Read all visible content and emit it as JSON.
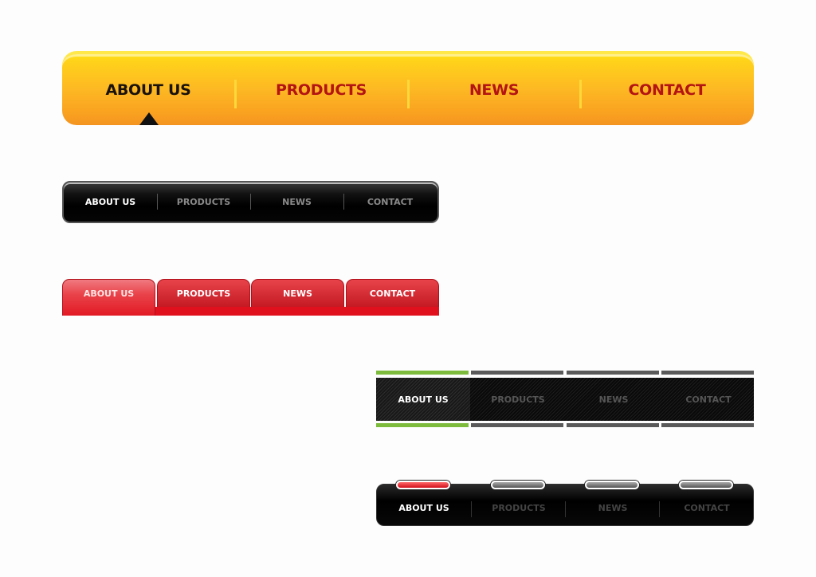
{
  "menu_items": [
    "ABOUT US",
    "PRODUCTS",
    "NEWS",
    "CONTACT"
  ],
  "active_item": "ABOUT US",
  "colors": {
    "orange_nav": "#fdb823",
    "orange_text": "#b31414",
    "black_nav": "#000000",
    "red_nav": "#e0101c",
    "green_accent": "#7dbb3c",
    "red_indicator": "#d10f1a"
  },
  "navs": [
    {
      "style": "orange-glossy",
      "items": [
        "ABOUT US",
        "PRODUCTS",
        "NEWS",
        "CONTACT"
      ]
    },
    {
      "style": "black-glossy",
      "items": [
        "ABOUT US",
        "PRODUCTS",
        "NEWS",
        "CONTACT"
      ]
    },
    {
      "style": "red-tabs",
      "items": [
        "ABOUT US",
        "PRODUCTS",
        "NEWS",
        "CONTACT"
      ]
    },
    {
      "style": "carbon-bars",
      "items": [
        "ABOUT US",
        "PRODUCTS",
        "NEWS",
        "CONTACT"
      ]
    },
    {
      "style": "black-pills",
      "items": [
        "ABOUT US",
        "PRODUCTS",
        "NEWS",
        "CONTACT"
      ]
    }
  ]
}
